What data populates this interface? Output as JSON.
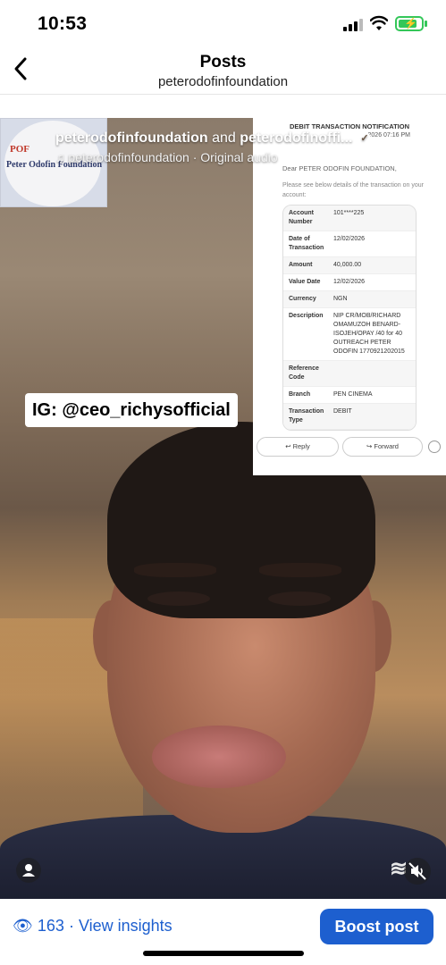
{
  "status_bar": {
    "time": "10:53"
  },
  "header": {
    "title": "Posts",
    "subtitle": "peterodofinfoundation"
  },
  "post": {
    "collab": {
      "account1": "peterodofinfoundation",
      "connector": "and",
      "account2": "peterodofinoffi..."
    },
    "audio": "peterodofinfoundation · Original audio",
    "logo_text": "Peter Odofin Foundation",
    "logo_mark": "POF",
    "overlay_label": "IG: @ceo_richysofficial",
    "more_label": "•••"
  },
  "receipt": {
    "heading": "DEBIT TRANSACTION NOTIFICATION",
    "time": "2026 07:16 PM",
    "greeting": "Dear PETER ODOFIN FOUNDATION,",
    "intro": "Please see below details of the transaction on your account:",
    "rows": [
      {
        "key": "Account Number",
        "value": "101****225"
      },
      {
        "key": "Date of Transaction",
        "value": "12/02/2026"
      },
      {
        "key": "Amount",
        "value": "40,000.00"
      },
      {
        "key": "Value Date",
        "value": "12/02/2026"
      },
      {
        "key": "Currency",
        "value": "NGN"
      },
      {
        "key": "Description",
        "value": "NIP CR/MOB/RICHARD OMAMUZOH BENARD-ISOJEH/OPAY /40 for 40 OUTREACH PETER ODOFIN 1770921202015"
      },
      {
        "key": "Reference Code",
        "value": ""
      },
      {
        "key": "Branch",
        "value": "PEN CINEMA"
      },
      {
        "key": "Transaction Type",
        "value": "DEBIT"
      }
    ],
    "reply_label": "Reply",
    "forward_label": "Forward"
  },
  "bottom": {
    "views": "163",
    "insights_label": "View insights",
    "boost_label": "Boost post"
  },
  "colors": {
    "accent": "#1d5fcf",
    "battery": "#34c759"
  }
}
